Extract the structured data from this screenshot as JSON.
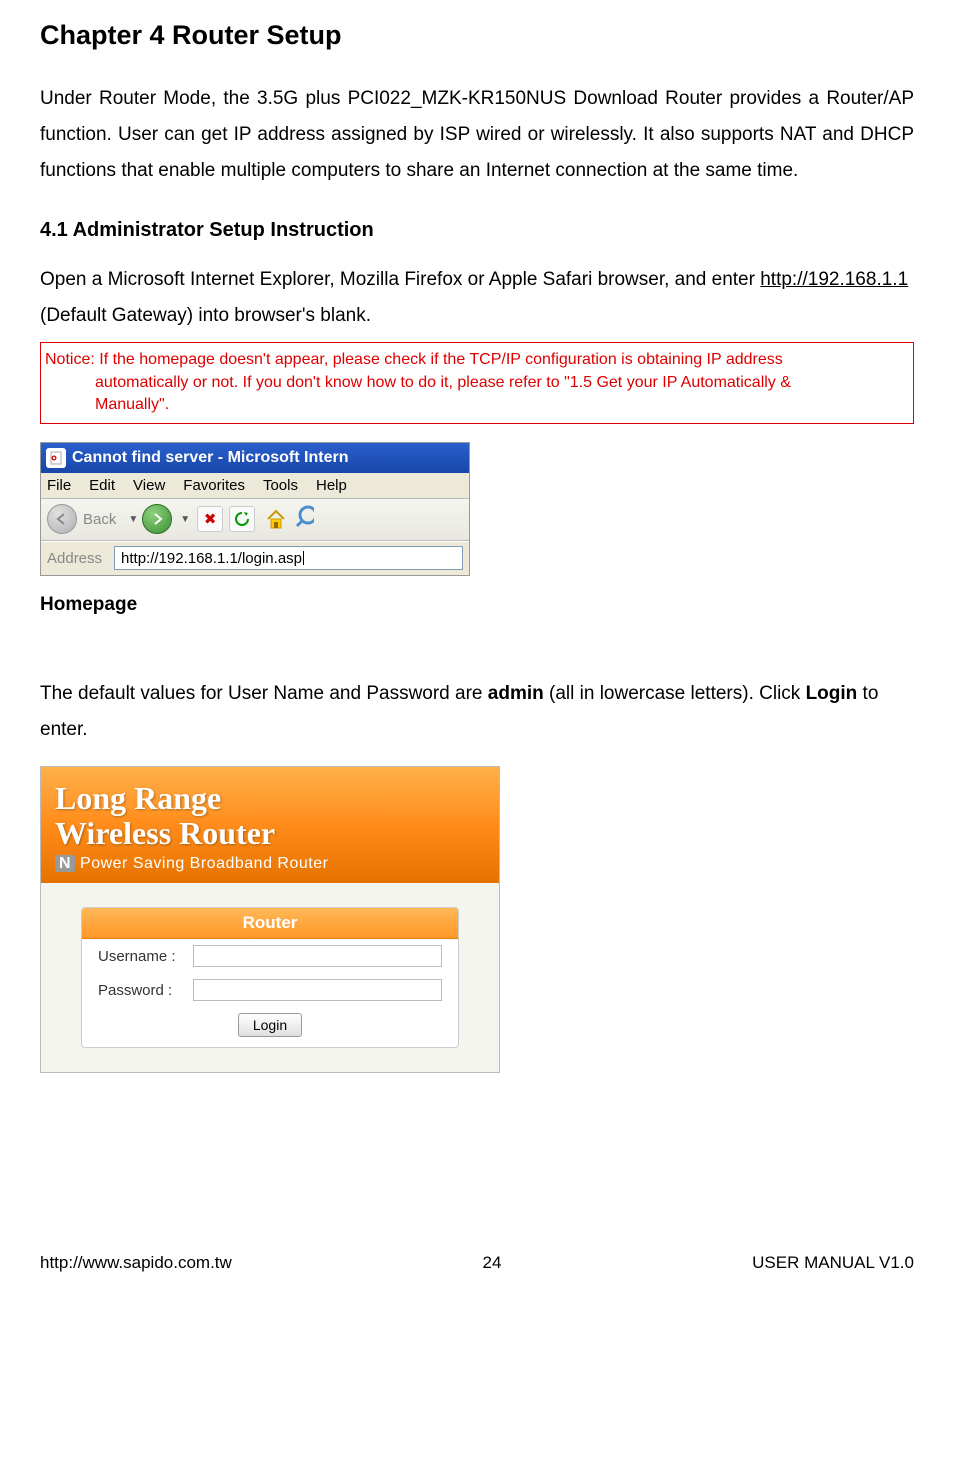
{
  "chapter": {
    "title": "Chapter 4     Router Setup",
    "intro": "Under Router Mode, the 3.5G plus PCI022_MZK-KR150NUS Download Router provides a Router/AP function. User can get IP address assigned by ISP wired or wirelessly. It also supports NAT and DHCP functions that enable multiple computers to share an Internet connection at the same time."
  },
  "section": {
    "number_title": "4.1     Administrator Setup Instruction",
    "text_before_link": "Open a Microsoft Internet Explorer, Mozilla Firefox or Apple Safari browser, and enter ",
    "link": "http://192.168.1.1",
    "text_after_link": " (Default Gateway) into browser's blank."
  },
  "notice": {
    "prefix": "Notice: ",
    "line1": "If the homepage doesn't appear, please check if the TCP/IP configuration is obtaining IP address",
    "line2": "automatically or not.   If you don't know how to do it, please refer to \"1.5 Get your IP Automatically &",
    "line3": "Manually\"."
  },
  "ie": {
    "title": "Cannot find server - Microsoft Intern",
    "menu": [
      "File",
      "Edit",
      "View",
      "Favorites",
      "Tools",
      "Help"
    ],
    "back_label": "Back",
    "address_label": "Address",
    "address_value": "http://192.168.1.1/login.asp"
  },
  "homepage_label": "Homepage",
  "login_intro": {
    "part1": "The default values for User Name and Password are ",
    "bold1": "admin",
    "part2": " (all in lowercase letters). Click ",
    "bold2": "Login",
    "part3": " to enter."
  },
  "login": {
    "title_line1": "Long Range",
    "title_line2": "Wireless Router",
    "subtitle": "N Power Saving Broadband Router",
    "panel_header": "Router",
    "username_label": "Username :",
    "password_label": "Password :",
    "login_button": "Login"
  },
  "footer": {
    "left": "http://www.sapido.com.tw",
    "center": "24",
    "right": "USER MANUAL V1.0"
  }
}
